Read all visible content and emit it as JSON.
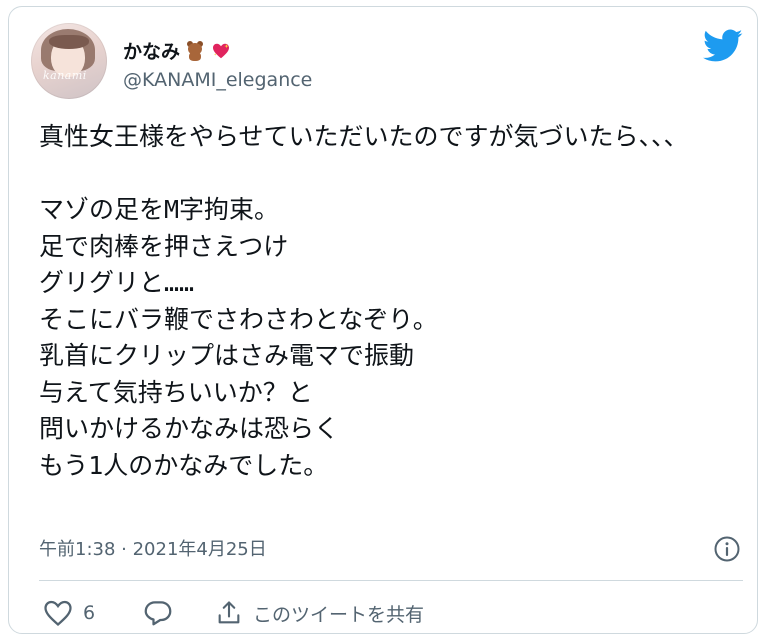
{
  "author": {
    "display_name": "かなみ",
    "username": "@KANAMI_elegance",
    "avatar_watermark": "kanami",
    "name_emoji": [
      "teddy-bear-emoji",
      "sparkling-heart-emoji"
    ]
  },
  "tweet": {
    "text": "真性女王様をやらせていただいたのですが気づいたら、、、\n\nマゾの足をM字拘束。\n足で肉棒を押さえつけ\nグリグリと……\nそこにバラ鞭でさわさわとなぞり。\n乳首にクリップはさみ電マで振動\n与えて気持ちいいか？と\n問いかけるかなみは恐らく\nもう1人のかなみでした。",
    "timestamp": "午前1:38 · 2021年4月25日"
  },
  "actions": {
    "like_count": "6",
    "share_label": "このツイートを共有"
  },
  "colors": {
    "twitter_blue": "#1d9bf0",
    "text_primary": "#0f1419",
    "text_secondary": "#536471",
    "border": "#cfd9de",
    "heart_red": "#e0245e"
  },
  "icons": {
    "brand": "twitter-bird-icon",
    "info": "info-icon",
    "like": "heart-outline-icon",
    "reply": "reply-bubble-icon",
    "share": "share-upload-icon"
  }
}
